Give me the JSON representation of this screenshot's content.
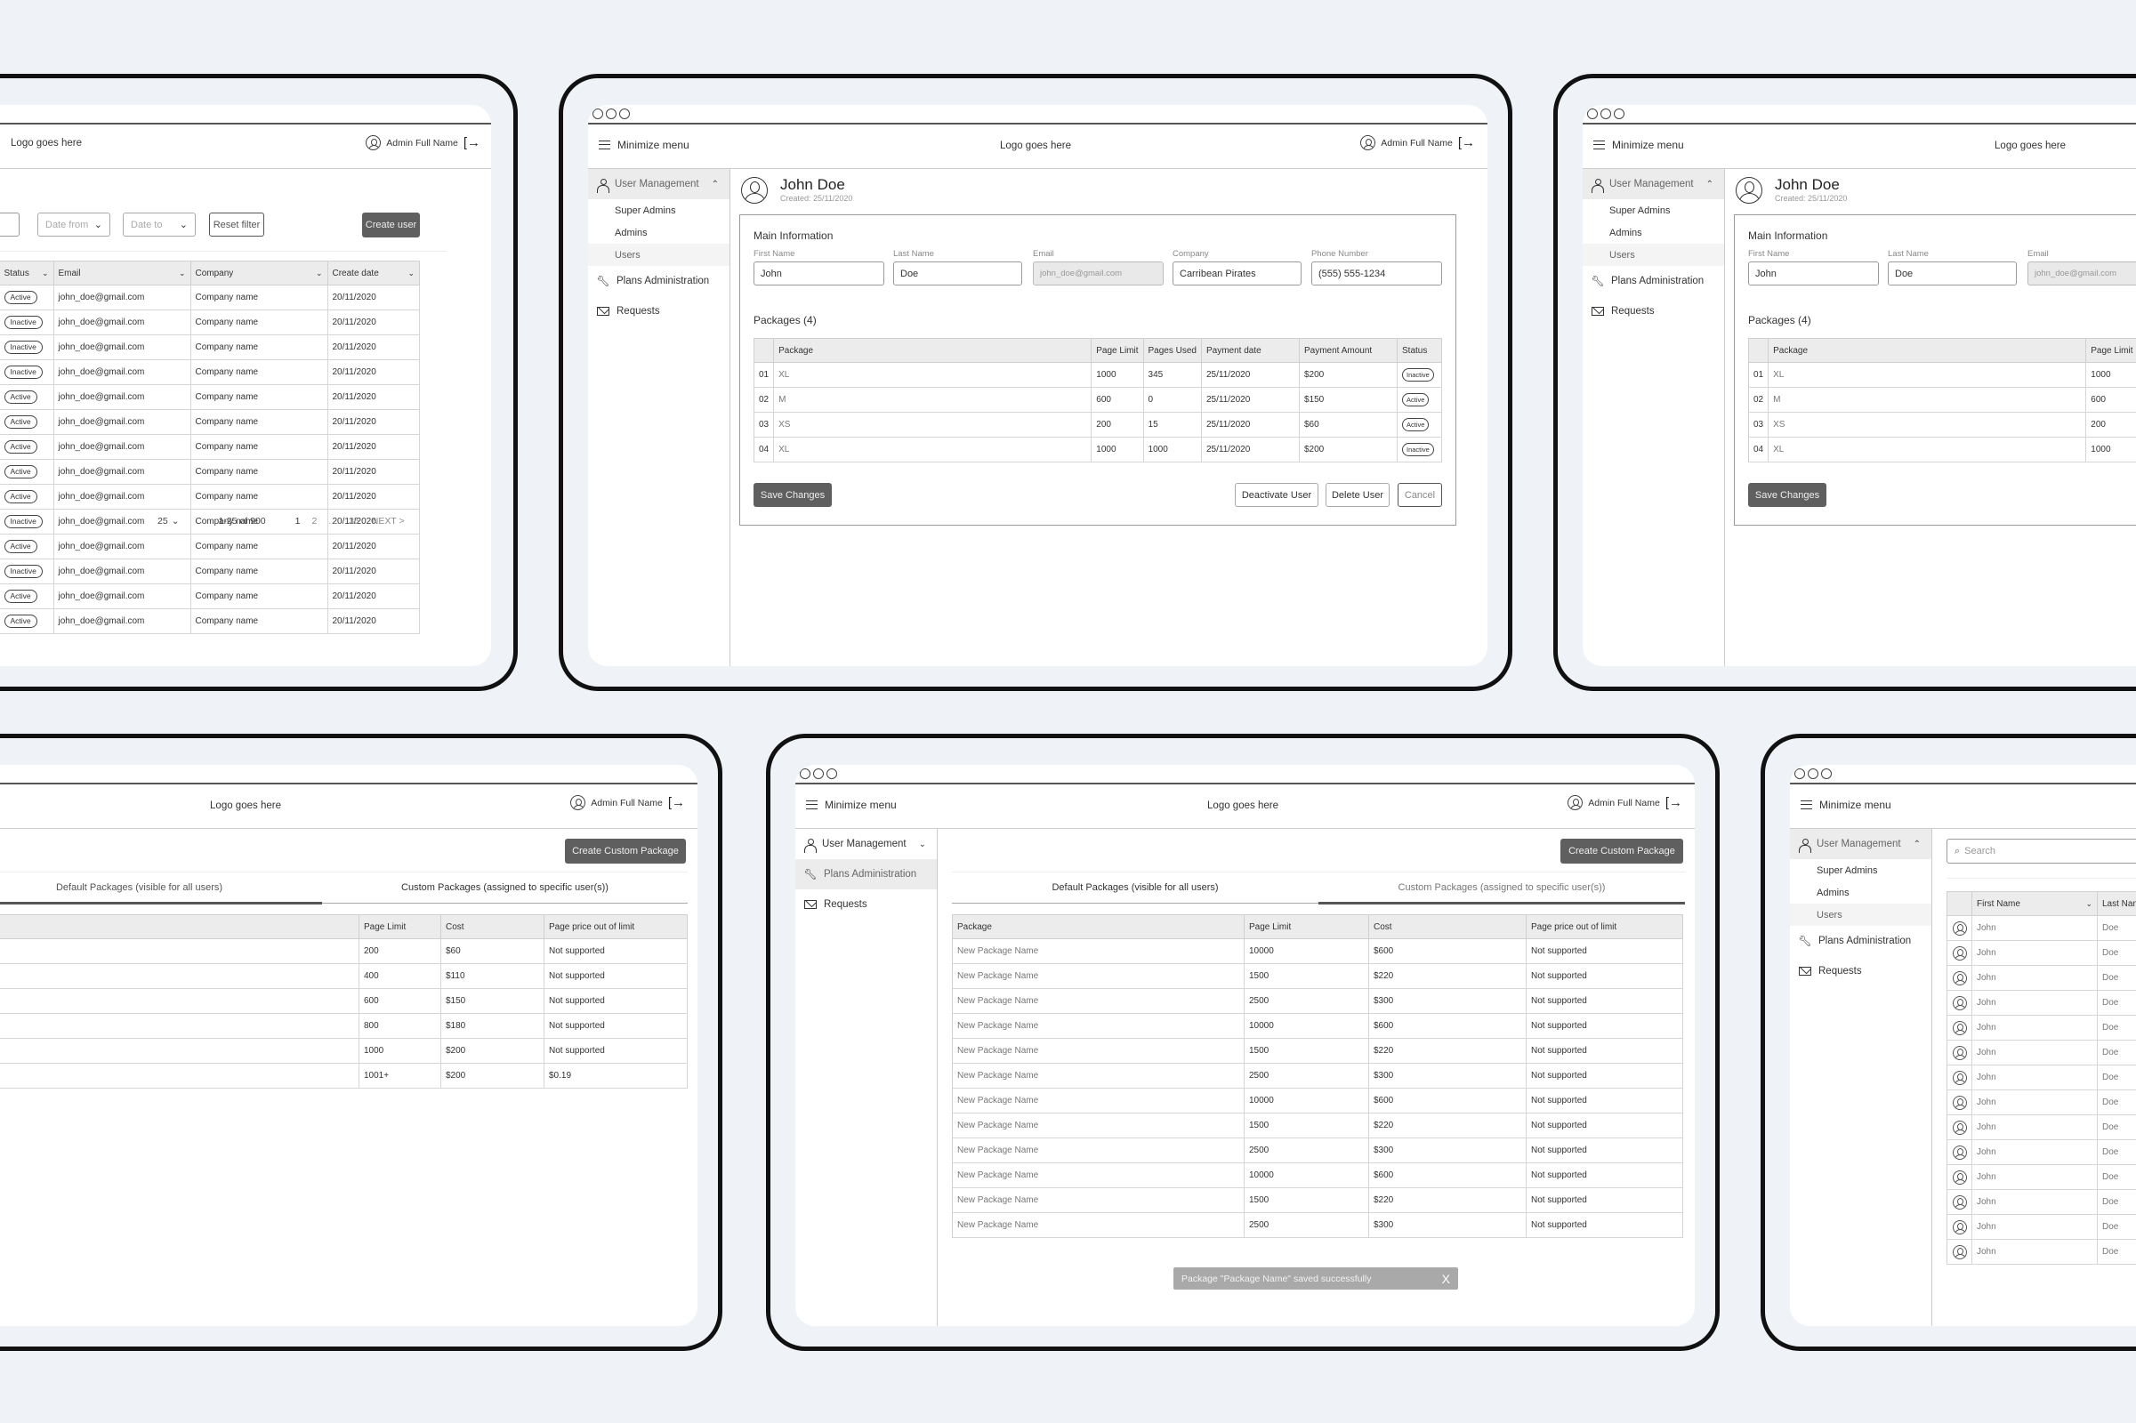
{
  "common": {
    "logo": "Logo goes here",
    "admin_name": "Admin Full Name",
    "minimize_menu": "Minimize menu",
    "icons": {
      "menu": "hamburger-icon",
      "avatar": "user-circle-icon",
      "logout": "logout-icon",
      "user": "user-icon",
      "wrench": "wrench-icon",
      "mail": "mail-icon",
      "search": "search-icon",
      "chevron_up": "chevron-up-icon",
      "chevron_down": "chevron-down-icon",
      "close": "close-icon"
    },
    "logout_glyph": "[→",
    "chev_up": "⌃",
    "chev_down": "⌄"
  },
  "sidebar": {
    "user_management": "User Management",
    "sub_items": [
      "Super Admins",
      "Admins",
      "Users"
    ],
    "plans_administration": "Plans Administration",
    "requests": "Requests"
  },
  "users_list_screen": {
    "filters": {
      "date_from": "Date from",
      "date_to": "Date to",
      "reset": "Reset filter"
    },
    "create_user": "Create user",
    "columns": [
      "Status",
      "Email",
      "Company",
      "Create date"
    ],
    "rows": [
      {
        "status": "Active",
        "email": "john_doe@gmail.com",
        "company": "Company name",
        "date": "20/11/2020"
      },
      {
        "status": "Inactive",
        "email": "john_doe@gmail.com",
        "company": "Company name",
        "date": "20/11/2020"
      },
      {
        "status": "Inactive",
        "email": "john_doe@gmail.com",
        "company": "Company name",
        "date": "20/11/2020"
      },
      {
        "status": "Inactive",
        "email": "john_doe@gmail.com",
        "company": "Company name",
        "date": "20/11/2020"
      },
      {
        "status": "Active",
        "email": "john_doe@gmail.com",
        "company": "Company name",
        "date": "20/11/2020"
      },
      {
        "status": "Active",
        "email": "john_doe@gmail.com",
        "company": "Company name",
        "date": "20/11/2020"
      },
      {
        "status": "Active",
        "email": "john_doe@gmail.com",
        "company": "Company name",
        "date": "20/11/2020"
      },
      {
        "status": "Active",
        "email": "john_doe@gmail.com",
        "company": "Company name",
        "date": "20/11/2020"
      },
      {
        "status": "Active",
        "email": "john_doe@gmail.com",
        "company": "Company name",
        "date": "20/11/2020"
      },
      {
        "status": "Inactive",
        "email": "john_doe@gmail.com",
        "company": "Company name",
        "date": "20/11/2020"
      },
      {
        "status": "Active",
        "email": "john_doe@gmail.com",
        "company": "Company name",
        "date": "20/11/2020"
      },
      {
        "status": "Inactive",
        "email": "john_doe@gmail.com",
        "company": "Company name",
        "date": "20/11/2020"
      },
      {
        "status": "Active",
        "email": "john_doe@gmail.com",
        "company": "Company name",
        "date": "20/11/2020"
      },
      {
        "status": "Active",
        "email": "john_doe@gmail.com",
        "company": "Company name",
        "date": "20/11/2020"
      }
    ],
    "pagination": {
      "per_page": "25",
      "range": "1-25 of 900",
      "pages": [
        "1",
        "2",
        "...",
        "35"
      ],
      "next": "NEXT >"
    }
  },
  "user_detail_screen": {
    "name": "John Doe",
    "created": "Created: 25/11/2020",
    "main_info_title": "Main Information",
    "fields": {
      "first_name": {
        "label": "First Name",
        "value": "John"
      },
      "last_name": {
        "label": "Last Name",
        "value": "Doe"
      },
      "email": {
        "label": "Email",
        "value": "john_doe@gmail.com"
      },
      "company": {
        "label": "Company",
        "value": "Carribean Pirates"
      },
      "phone": {
        "label": "Phone Number",
        "value": "(555) 555-1234"
      }
    },
    "packages_title": "Packages (4)",
    "package_columns": [
      "Package",
      "Page Limit",
      "Pages Used",
      "Payment date",
      "Payment Amount",
      "Status"
    ],
    "packages": [
      {
        "num": "01",
        "package": "XL",
        "limit": "1000",
        "used": "345",
        "date": "25/11/2020",
        "amount": "$200",
        "status": "Inactive"
      },
      {
        "num": "02",
        "package": "M",
        "limit": "600",
        "used": "0",
        "date": "25/11/2020",
        "amount": "$150",
        "status": "Active"
      },
      {
        "num": "03",
        "package": "XS",
        "limit": "200",
        "used": "15",
        "date": "25/11/2020",
        "amount": "$60",
        "status": "Active"
      },
      {
        "num": "04",
        "package": "XL",
        "limit": "1000",
        "used": "1000",
        "date": "25/11/2020",
        "amount": "$200",
        "status": "Inactive"
      }
    ],
    "buttons": {
      "save": "Save Changes",
      "deactivate": "Deactivate User",
      "delete": "Delete User",
      "cancel": "Cancel"
    }
  },
  "plans_screen": {
    "create_button": "Create Custom Package",
    "tabs": {
      "default": "Default Packages (visible for all users)",
      "custom": "Custom Packages (assigned to specific user(s))"
    },
    "columns": [
      "Package",
      "Page Limit",
      "Cost",
      "Page price out of limit"
    ],
    "default_rows": [
      {
        "limit": "200",
        "cost": "$60",
        "out": "Not supported"
      },
      {
        "limit": "400",
        "cost": "$110",
        "out": "Not supported"
      },
      {
        "limit": "600",
        "cost": "$150",
        "out": "Not supported"
      },
      {
        "limit": "800",
        "cost": "$180",
        "out": "Not supported"
      },
      {
        "limit": "1000",
        "cost": "$200",
        "out": "Not supported"
      },
      {
        "limit": "1001+",
        "cost": "$200",
        "out": "$0.19"
      }
    ],
    "custom_rows": [
      {
        "name": "New Package Name",
        "limit": "10000",
        "cost": "$600",
        "out": "Not supported"
      },
      {
        "name": "New Package Name",
        "limit": "1500",
        "cost": "$220",
        "out": "Not supported"
      },
      {
        "name": "New Package Name",
        "limit": "2500",
        "cost": "$300",
        "out": "Not supported"
      },
      {
        "name": "New Package Name",
        "limit": "10000",
        "cost": "$600",
        "out": "Not supported"
      },
      {
        "name": "New Package Name",
        "limit": "1500",
        "cost": "$220",
        "out": "Not supported"
      },
      {
        "name": "New Package Name",
        "limit": "2500",
        "cost": "$300",
        "out": "Not supported"
      },
      {
        "name": "New Package Name",
        "limit": "10000",
        "cost": "$600",
        "out": "Not supported"
      },
      {
        "name": "New Package Name",
        "limit": "1500",
        "cost": "$220",
        "out": "Not supported"
      },
      {
        "name": "New Package Name",
        "limit": "2500",
        "cost": "$300",
        "out": "Not supported"
      },
      {
        "name": "New Package Name",
        "limit": "10000",
        "cost": "$600",
        "out": "Not supported"
      },
      {
        "name": "New Package Name",
        "limit": "1500",
        "cost": "$220",
        "out": "Not supported"
      },
      {
        "name": "New Package Name",
        "limit": "2500",
        "cost": "$300",
        "out": "Not supported"
      }
    ],
    "toast": "Package \"Package Name\" saved successfully",
    "toast_close": "X"
  },
  "users_search_screen": {
    "search_placeholder": "Search",
    "columns": [
      "First Name",
      "Last Nam"
    ],
    "rows": [
      {
        "first": "John",
        "last": "Doe"
      },
      {
        "first": "John",
        "last": "Doe"
      },
      {
        "first": "John",
        "last": "Doe"
      },
      {
        "first": "John",
        "last": "Doe"
      },
      {
        "first": "John",
        "last": "Doe"
      },
      {
        "first": "John",
        "last": "Doe"
      },
      {
        "first": "John",
        "last": "Doe"
      },
      {
        "first": "John",
        "last": "Doe"
      },
      {
        "first": "John",
        "last": "Doe"
      },
      {
        "first": "John",
        "last": "Doe"
      },
      {
        "first": "John",
        "last": "Doe"
      },
      {
        "first": "John",
        "last": "Doe"
      },
      {
        "first": "John",
        "last": "Doe"
      },
      {
        "first": "John",
        "last": "Doe"
      }
    ]
  },
  "colors": {
    "background": "#eff3f8",
    "frame": "#111111",
    "dark_button": "#5f5f5f",
    "header_bg": "#ececec",
    "toast": "#a9a9a9"
  }
}
